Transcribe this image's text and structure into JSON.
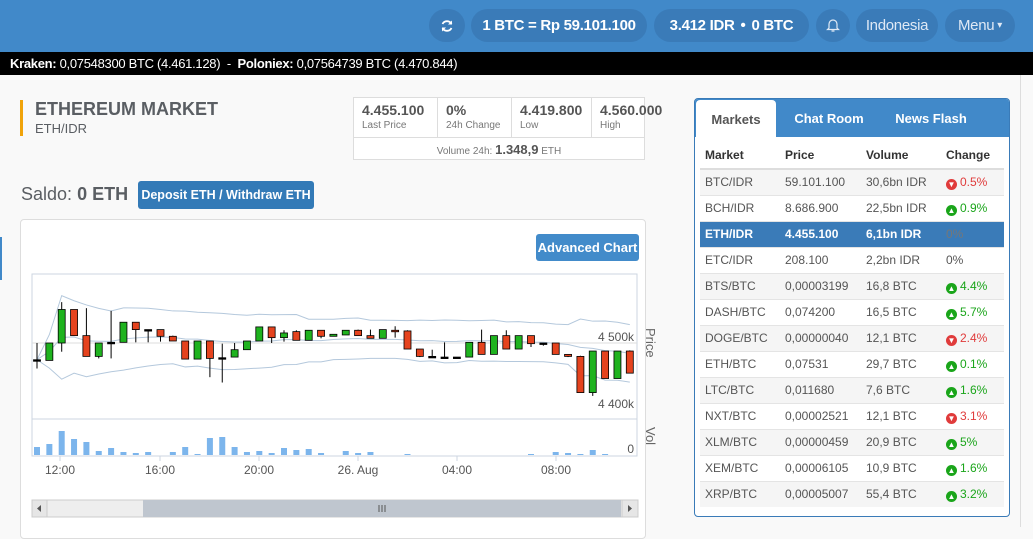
{
  "nav": {
    "refresh_icon": "refresh-icon",
    "btc_rate": "1 BTC = Rp 59.101.100",
    "balance": "3.412 IDR",
    "balance_sep": "•",
    "balance_btc": "0 BTC",
    "bell_icon": "bell-icon",
    "language": "Indonesia",
    "menu": "Menu",
    "menu_caret": "▾"
  },
  "ticker": {
    "kraken_label": "Kraken:",
    "kraken_value": "0,07548300 BTC (4.461.128)",
    "sep": "-",
    "poloniex_label": "Poloniex:",
    "poloniex_value": "0,07564739 BTC (4.470.844)"
  },
  "market": {
    "title": "ETHEREUM MARKET",
    "pair": "ETH/IDR",
    "stats": [
      {
        "value": "4.455.100",
        "label": "Last Price"
      },
      {
        "value": "0%",
        "label": "24h Change"
      },
      {
        "value": "4.419.800",
        "label": "Low"
      },
      {
        "value": "4.560.000",
        "label": "High"
      }
    ],
    "volume_label": "Volume 24h:",
    "volume_value": "1.348,9",
    "volume_unit": "ETH"
  },
  "saldo": {
    "label": "Saldo:",
    "value": "0 ETH",
    "button": "Deposit ETH / Withdraw ETH"
  },
  "chart": {
    "advanced_button": "Advanced Chart"
  },
  "chart_data": {
    "type": "candlestick",
    "price_axis_label": "Price",
    "volume_axis_label": "Vol",
    "price_ticks": [
      "4 500k",
      "4 400k"
    ],
    "price_tick_values": [
      4500,
      4400
    ],
    "volume_ticks": [
      "0"
    ],
    "x_ticks": [
      "12:00",
      "16:00",
      "20:00",
      "26. Aug",
      "04:00",
      "08:00"
    ],
    "interval": "30 min",
    "price_unit": "k IDR",
    "ohlc": [
      [
        4475,
        4500,
        4462,
        4475
      ],
      [
        4474,
        4500,
        4474,
        4500
      ],
      [
        4500,
        4561,
        4487,
        4550
      ],
      [
        4550,
        4550,
        4511,
        4511
      ],
      [
        4511,
        4552,
        4480,
        4480
      ],
      [
        4480,
        4500,
        4477,
        4500
      ],
      [
        4501,
        4548,
        4477,
        4501
      ],
      [
        4501,
        4531,
        4501,
        4531
      ],
      [
        4531,
        4531,
        4501,
        4520
      ],
      [
        4520,
        4520,
        4501,
        4520
      ],
      [
        4520,
        4520,
        4502,
        4510
      ],
      [
        4510,
        4511,
        4503,
        4503
      ],
      [
        4503,
        4503,
        4476,
        4476
      ],
      [
        4476,
        4503,
        4476,
        4503
      ],
      [
        4503,
        4503,
        4449,
        4477
      ],
      [
        4478,
        4499,
        4441,
        4478
      ],
      [
        4479,
        4500,
        4479,
        4490
      ],
      [
        4490,
        4503,
        4490,
        4503
      ],
      [
        4503,
        4524,
        4503,
        4524
      ],
      [
        4524,
        4524,
        4500,
        4508
      ],
      [
        4508,
        4519,
        4502,
        4515
      ],
      [
        4517,
        4519,
        4504,
        4504
      ],
      [
        4504,
        4519,
        4504,
        4519
      ],
      [
        4519,
        4519,
        4507,
        4510
      ],
      [
        4510,
        4513,
        4510,
        4513
      ],
      [
        4512,
        4519,
        4512,
        4519
      ],
      [
        4519,
        4520,
        4511,
        4511
      ],
      [
        4511,
        4520,
        4507,
        4507
      ],
      [
        4507,
        4520,
        4507,
        4520
      ],
      [
        4519,
        4525,
        4508,
        4518
      ],
      [
        4518,
        4519,
        4491,
        4491
      ],
      [
        4491,
        4491,
        4479,
        4480
      ],
      [
        4480,
        4490,
        4479,
        4480
      ],
      [
        4479,
        4501,
        4479,
        4479
      ],
      [
        4479,
        4479,
        4479,
        4479
      ],
      [
        4479,
        4501,
        4479,
        4501
      ],
      [
        4501,
        4520,
        4483,
        4483
      ],
      [
        4483,
        4511,
        4483,
        4511
      ],
      [
        4511,
        4519,
        4491,
        4491
      ],
      [
        4491,
        4511,
        4491,
        4511
      ],
      [
        4511,
        4511,
        4494,
        4499
      ],
      [
        4500,
        4500,
        4496,
        4500
      ],
      [
        4500,
        4500,
        4483,
        4483
      ],
      [
        4483,
        4483,
        4479,
        4480
      ],
      [
        4480,
        4481,
        4426,
        4426
      ],
      [
        4426,
        4488,
        4421,
        4488
      ],
      [
        4488,
        4488,
        4447,
        4447
      ],
      [
        4447,
        4488,
        4447,
        4488
      ],
      [
        4488,
        4489,
        4455,
        4455
      ]
    ],
    "volume_relative": [
      24,
      33,
      72,
      48,
      39,
      12,
      21,
      9,
      6,
      9,
      0,
      9,
      24,
      3,
      51,
      54,
      24,
      9,
      12,
      6,
      21,
      15,
      18,
      6,
      0,
      12,
      6,
      9,
      0,
      0,
      3,
      0,
      0,
      0,
      0,
      0,
      0,
      0,
      0,
      0,
      3,
      0,
      9,
      6,
      3,
      15,
      3,
      0,
      0
    ],
    "colors": {
      "up": "#1fb31f",
      "down": "#e5431e",
      "volume": "#7cb5ec",
      "bands": "#b4c8dc"
    }
  },
  "sidebar": {
    "tabs": [
      "Markets",
      "Chat Room",
      "News Flash"
    ],
    "headers": [
      "Market",
      "Price",
      "Volume",
      "Change"
    ],
    "rows": [
      {
        "market": "BTC/IDR",
        "price": "59.101.100",
        "volume": "30,6bn IDR",
        "change": "0.5%",
        "dir": "down"
      },
      {
        "market": "BCH/IDR",
        "price": "8.686.900",
        "volume": "22,5bn IDR",
        "change": "0.9%",
        "dir": "up"
      },
      {
        "market": "ETH/IDR",
        "price": "4.455.100",
        "volume": "6,1bn IDR",
        "change": "0%",
        "dir": "none",
        "selected": true
      },
      {
        "market": "ETC/IDR",
        "price": "208.100",
        "volume": "2,2bn IDR",
        "change": "0%",
        "dir": "none"
      },
      {
        "market": "BTS/BTC",
        "price": "0,00003199",
        "volume": "16,8 BTC",
        "change": "4.4%",
        "dir": "up"
      },
      {
        "market": "DASH/BTC",
        "price": "0,074200",
        "volume": "16,5 BTC",
        "change": "5.7%",
        "dir": "up"
      },
      {
        "market": "DOGE/BTC",
        "price": "0,00000040",
        "volume": "12,1 BTC",
        "change": "2.4%",
        "dir": "down"
      },
      {
        "market": "ETH/BTC",
        "price": "0,07531",
        "volume": "29,7 BTC",
        "change": "0.1%",
        "dir": "up"
      },
      {
        "market": "LTC/BTC",
        "price": "0,011680",
        "volume": "7,6 BTC",
        "change": "1.6%",
        "dir": "up"
      },
      {
        "market": "NXT/BTC",
        "price": "0,00002521",
        "volume": "12,1 BTC",
        "change": "3.1%",
        "dir": "down"
      },
      {
        "market": "XLM/BTC",
        "price": "0,00000459",
        "volume": "20,9 BTC",
        "change": "5%",
        "dir": "up"
      },
      {
        "market": "XEM/BTC",
        "price": "0,00006105",
        "volume": "10,9 BTC",
        "change": "1.6%",
        "dir": "up"
      },
      {
        "market": "XRP/BTC",
        "price": "0,00005007",
        "volume": "55,4 BTC",
        "change": "3.2%",
        "dir": "up"
      }
    ]
  }
}
